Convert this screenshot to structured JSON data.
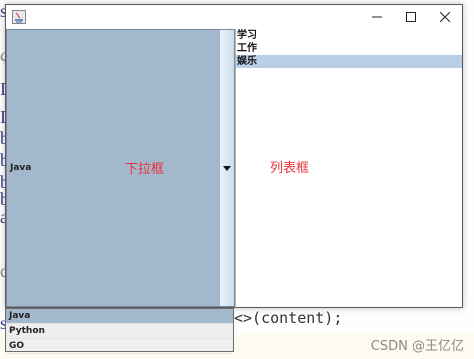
{
  "background": {
    "glyphs": [
      "s",
      "ς",
      "I",
      "I",
      "b",
      "b",
      "b",
      "b",
      "a",
      "d",
      "s",
      "a"
    ],
    "code_fragment": "<>(content);",
    "watermark": "CSDN @王亿亿"
  },
  "window": {
    "title": "",
    "controls": {
      "minimize": "minimize",
      "maximize": "maximize",
      "close": "close"
    }
  },
  "combo": {
    "selected_value": "Java",
    "label": "下拉框",
    "options": [
      "Java",
      "Python",
      "GO"
    ],
    "selected_index": 0
  },
  "list": {
    "label": "列表框",
    "items": [
      "学习",
      "工作",
      "娱乐"
    ],
    "selected_index": 2
  },
  "colors": {
    "combo_background": "#a3b8cc",
    "list_selection": "#b8cfe5",
    "label_red": "#e6323a"
  }
}
